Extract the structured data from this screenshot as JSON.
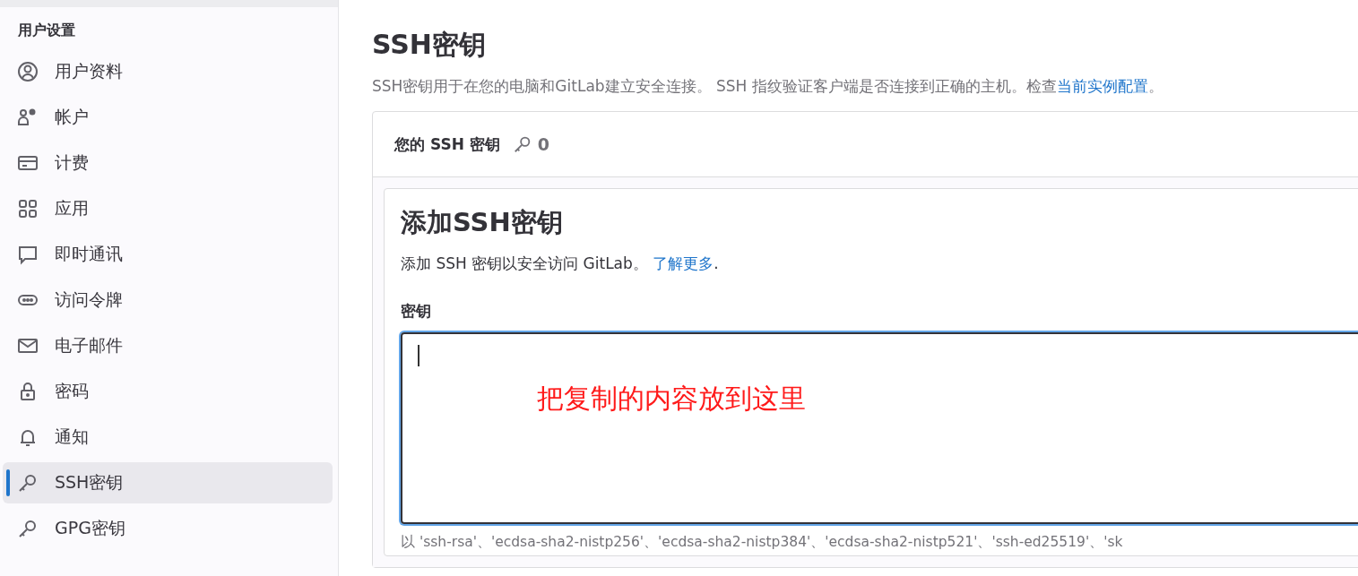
{
  "sidebar": {
    "heading": "用户设置",
    "items": [
      {
        "label": "用户资料",
        "selected": false
      },
      {
        "label": "帐户",
        "selected": false
      },
      {
        "label": "计费",
        "selected": false
      },
      {
        "label": "应用",
        "selected": false
      },
      {
        "label": "即时通讯",
        "selected": false
      },
      {
        "label": "访问令牌",
        "selected": false
      },
      {
        "label": "电子邮件",
        "selected": false
      },
      {
        "label": "密码",
        "selected": false
      },
      {
        "label": "通知",
        "selected": false
      },
      {
        "label": "SSH密钥",
        "selected": true
      },
      {
        "label": "GPG密钥",
        "selected": false
      }
    ]
  },
  "page": {
    "title": "SSH密钥",
    "description": "SSH密钥用于在您的电脑和GitLab建立安全连接。 SSH 指纹验证客户端是否连接到正确的主机。检查",
    "description_link": "当前实例配置",
    "description_end": "。"
  },
  "keys_card": {
    "title": "您的 SSH 密钥",
    "count": "0"
  },
  "add_form": {
    "title": "添加SSH密钥",
    "intro": "添加 SSH 密钥以安全访问 GitLab。",
    "intro_link": "了解更多",
    "intro_end": ".",
    "key_label": "密钥",
    "annotation": "把复制的内容放到这里",
    "help": "以 'ssh-rsa'、'ecdsa-sha2-nistp256'、'ecdsa-sha2-nistp384'、'ecdsa-sha2-nistp521'、'ssh-ed25519'、'sk"
  }
}
